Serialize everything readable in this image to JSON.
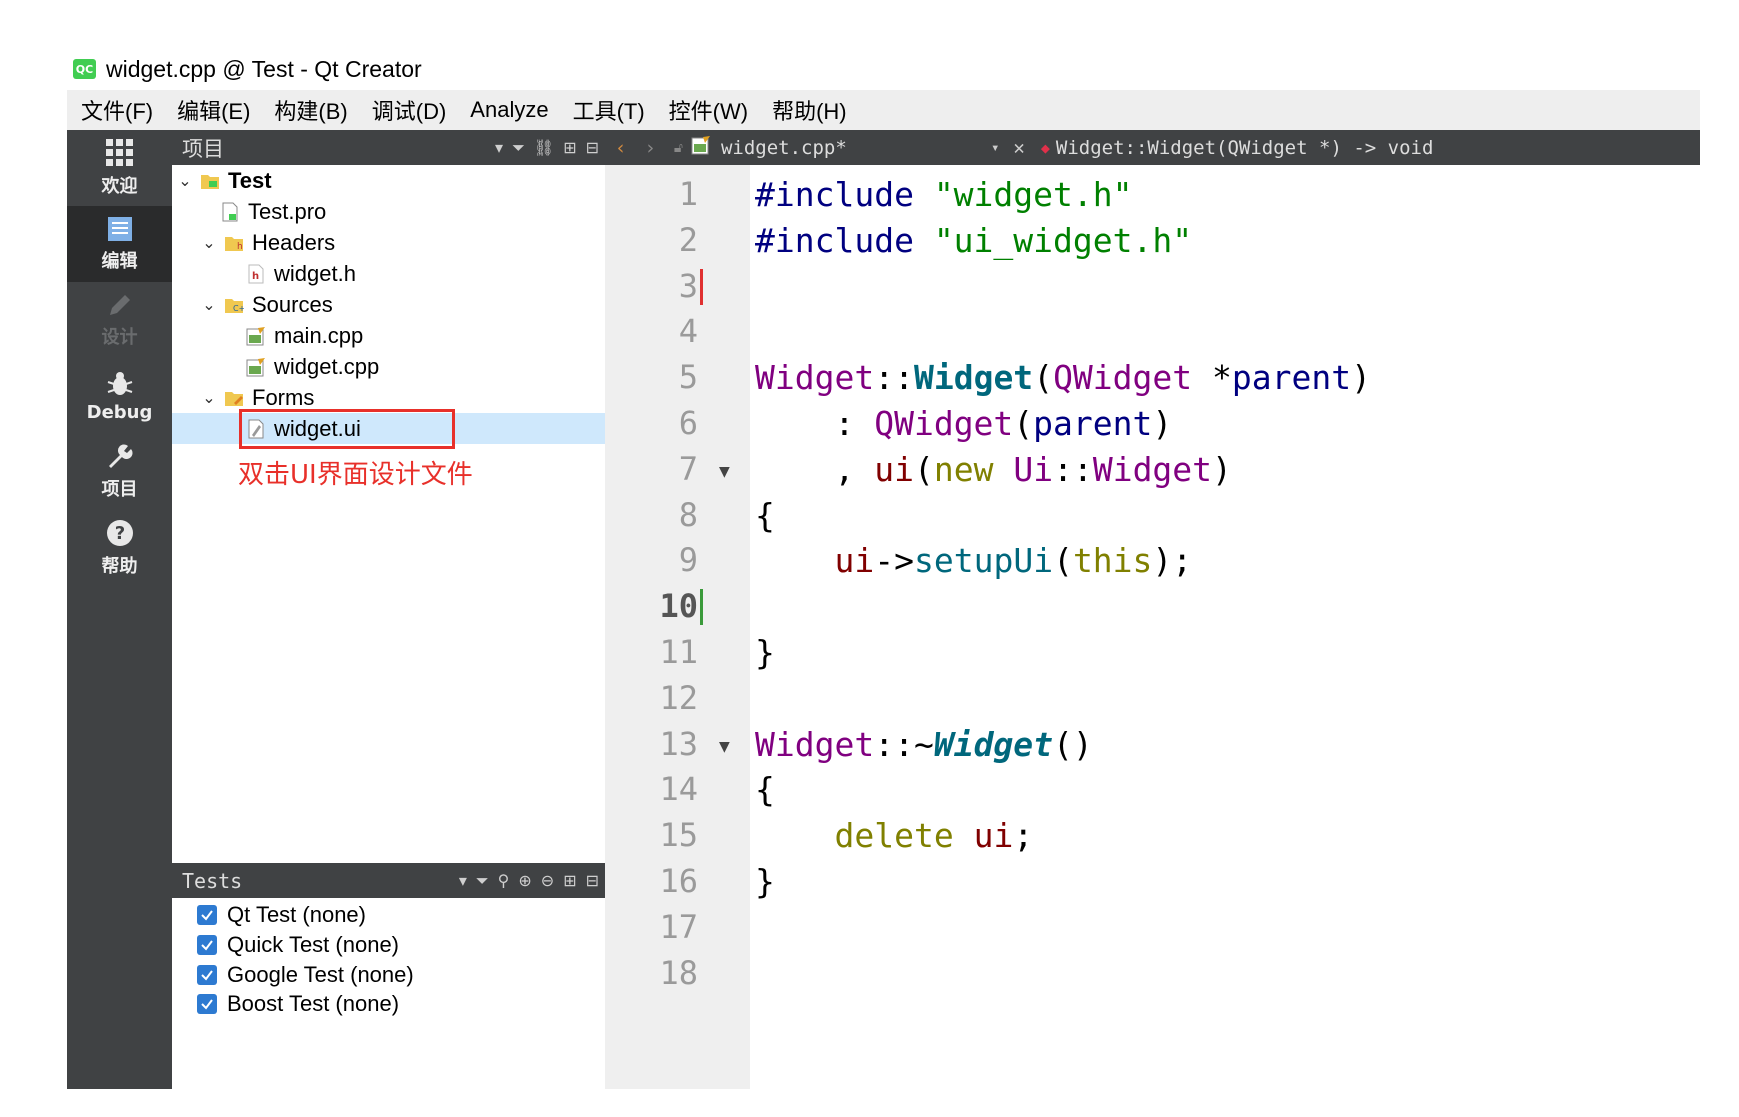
{
  "window": {
    "title": "widget.cpp @ Test - Qt Creator",
    "logo_text": "QC"
  },
  "menu": [
    "文件(F)",
    "编辑(E)",
    "构建(B)",
    "调试(D)",
    "Analyze",
    "工具(T)",
    "控件(W)",
    "帮助(H)"
  ],
  "modes": [
    {
      "label": "欢迎",
      "icon": "grid-icon",
      "state": "normal"
    },
    {
      "label": "编辑",
      "icon": "document-icon",
      "state": "active"
    },
    {
      "label": "设计",
      "icon": "pencil-icon",
      "state": "disabled"
    },
    {
      "label": "Debug",
      "icon": "bug-icon",
      "state": "normal"
    },
    {
      "label": "项目",
      "icon": "wrench-icon",
      "state": "normal"
    },
    {
      "label": "帮助",
      "icon": "help-icon",
      "state": "normal"
    }
  ],
  "project_pane": {
    "title": "项目",
    "tree": [
      {
        "label": "Test",
        "level": 0,
        "expanded": true,
        "icon": "project-folder-icon",
        "bold": true
      },
      {
        "label": "Test.pro",
        "level": 1,
        "icon": "pro-file-icon"
      },
      {
        "label": "Headers",
        "level": 1,
        "expanded": true,
        "icon": "header-folder-icon"
      },
      {
        "label": "widget.h",
        "level": 2,
        "icon": "header-file-icon"
      },
      {
        "label": "Sources",
        "level": 1,
        "expanded": true,
        "icon": "source-folder-icon"
      },
      {
        "label": "main.cpp",
        "level": 2,
        "icon": "cpp-file-icon"
      },
      {
        "label": "widget.cpp",
        "level": 2,
        "icon": "cpp-file-icon"
      },
      {
        "label": "Forms",
        "level": 1,
        "expanded": true,
        "icon": "forms-folder-icon"
      },
      {
        "label": "widget.ui",
        "level": 2,
        "icon": "ui-file-icon",
        "selected": true
      }
    ],
    "annotation": "双击UI界面设计文件"
  },
  "tests_pane": {
    "title": "Tests",
    "items": [
      "Qt Test (none)",
      "Quick Test (none)",
      "Google Test (none)",
      "Boost Test (none)"
    ]
  },
  "editor_bar": {
    "file": "widget.cpp*",
    "symbol": "Widget::Widget(QWidget *) -> void"
  },
  "editor": {
    "current_line": 10,
    "lines": [
      {
        "n": "1",
        "tokens": [
          [
            "#include ",
            "kw-pp"
          ],
          [
            "\"widget.h\"",
            "str"
          ]
        ]
      },
      {
        "n": "2",
        "tokens": [
          [
            "#include ",
            "kw-pp"
          ],
          [
            "\"ui_widget.h\"",
            "str"
          ]
        ]
      },
      {
        "n": "3",
        "tokens": []
      },
      {
        "n": "4",
        "tokens": []
      },
      {
        "n": "5",
        "tokens": [
          [
            "Widget",
            "typ"
          ],
          [
            "::",
            "blk"
          ],
          [
            "Widget",
            "fn bold"
          ],
          [
            "(",
            "blk"
          ],
          [
            "QWidget",
            "typ"
          ],
          [
            " *",
            "blk"
          ],
          [
            "parent",
            "kw-pp"
          ],
          [
            ")",
            "blk"
          ]
        ]
      },
      {
        "n": "6",
        "tokens": [
          [
            "    : ",
            "blk"
          ],
          [
            "QWidget",
            "typ"
          ],
          [
            "(",
            "blk"
          ],
          [
            "parent",
            "kw-pp"
          ],
          [
            ")",
            "blk"
          ]
        ]
      },
      {
        "n": "7",
        "tokens": [
          [
            "    , ",
            "blk"
          ],
          [
            "ui",
            "mem"
          ],
          [
            "(",
            "blk"
          ],
          [
            "new",
            "kw"
          ],
          [
            " ",
            "blk"
          ],
          [
            "Ui",
            "typ"
          ],
          [
            "::",
            "blk"
          ],
          [
            "Widget",
            "typ"
          ],
          [
            ")",
            "blk"
          ]
        ]
      },
      {
        "n": "8",
        "tokens": [
          [
            "{",
            "blk"
          ]
        ]
      },
      {
        "n": "9",
        "tokens": [
          [
            "    ",
            "blk"
          ],
          [
            "ui",
            "mem"
          ],
          [
            "->",
            "blk"
          ],
          [
            "setupUi",
            "fn"
          ],
          [
            "(",
            "blk"
          ],
          [
            "this",
            "kw"
          ],
          [
            ");",
            "blk"
          ]
        ]
      },
      {
        "n": "10",
        "tokens": []
      },
      {
        "n": "11",
        "tokens": [
          [
            "}",
            "blk"
          ]
        ]
      },
      {
        "n": "12",
        "tokens": []
      },
      {
        "n": "13",
        "tokens": [
          [
            "Widget",
            "typ"
          ],
          [
            "::~",
            "blk"
          ],
          [
            "Widget",
            "fn ital"
          ],
          [
            "()",
            "blk"
          ]
        ]
      },
      {
        "n": "14",
        "tokens": [
          [
            "{",
            "blk"
          ]
        ]
      },
      {
        "n": "15",
        "tokens": [
          [
            "    ",
            "blk"
          ],
          [
            "delete",
            "kw"
          ],
          [
            " ",
            "blk"
          ],
          [
            "ui",
            "mem"
          ],
          [
            ";",
            "blk"
          ]
        ]
      },
      {
        "n": "16",
        "tokens": [
          [
            "}",
            "blk"
          ]
        ]
      },
      {
        "n": "17",
        "tokens": []
      },
      {
        "n": "18",
        "tokens": []
      }
    ],
    "fold_lines": [
      "7",
      "13"
    ]
  },
  "colors": {
    "sidebar": "#404244",
    "selection": "#cfe8fc",
    "annotation": "#e8302a",
    "checkbox": "#2d7ad1"
  }
}
